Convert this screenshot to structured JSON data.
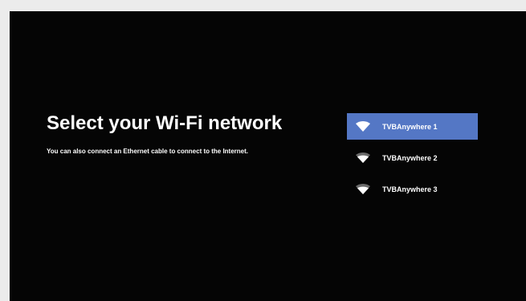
{
  "page": {
    "title": "Select your Wi-Fi network",
    "subtitle": "You can also connect an Ethernet cable to connect to the Internet."
  },
  "networks": [
    {
      "label": "TVBAnywhere 1",
      "icon": "wifi-icon",
      "selected": true,
      "signal": "full"
    },
    {
      "label": "TVBAnywhere 2",
      "icon": "wifi-icon",
      "selected": false,
      "signal": "partial"
    },
    {
      "label": "TVBAnywhere 3",
      "icon": "wifi-icon",
      "selected": false,
      "signal": "partial"
    }
  ],
  "colors": {
    "background": "#050505",
    "selected": "#5477c5",
    "text": "#ffffff"
  }
}
